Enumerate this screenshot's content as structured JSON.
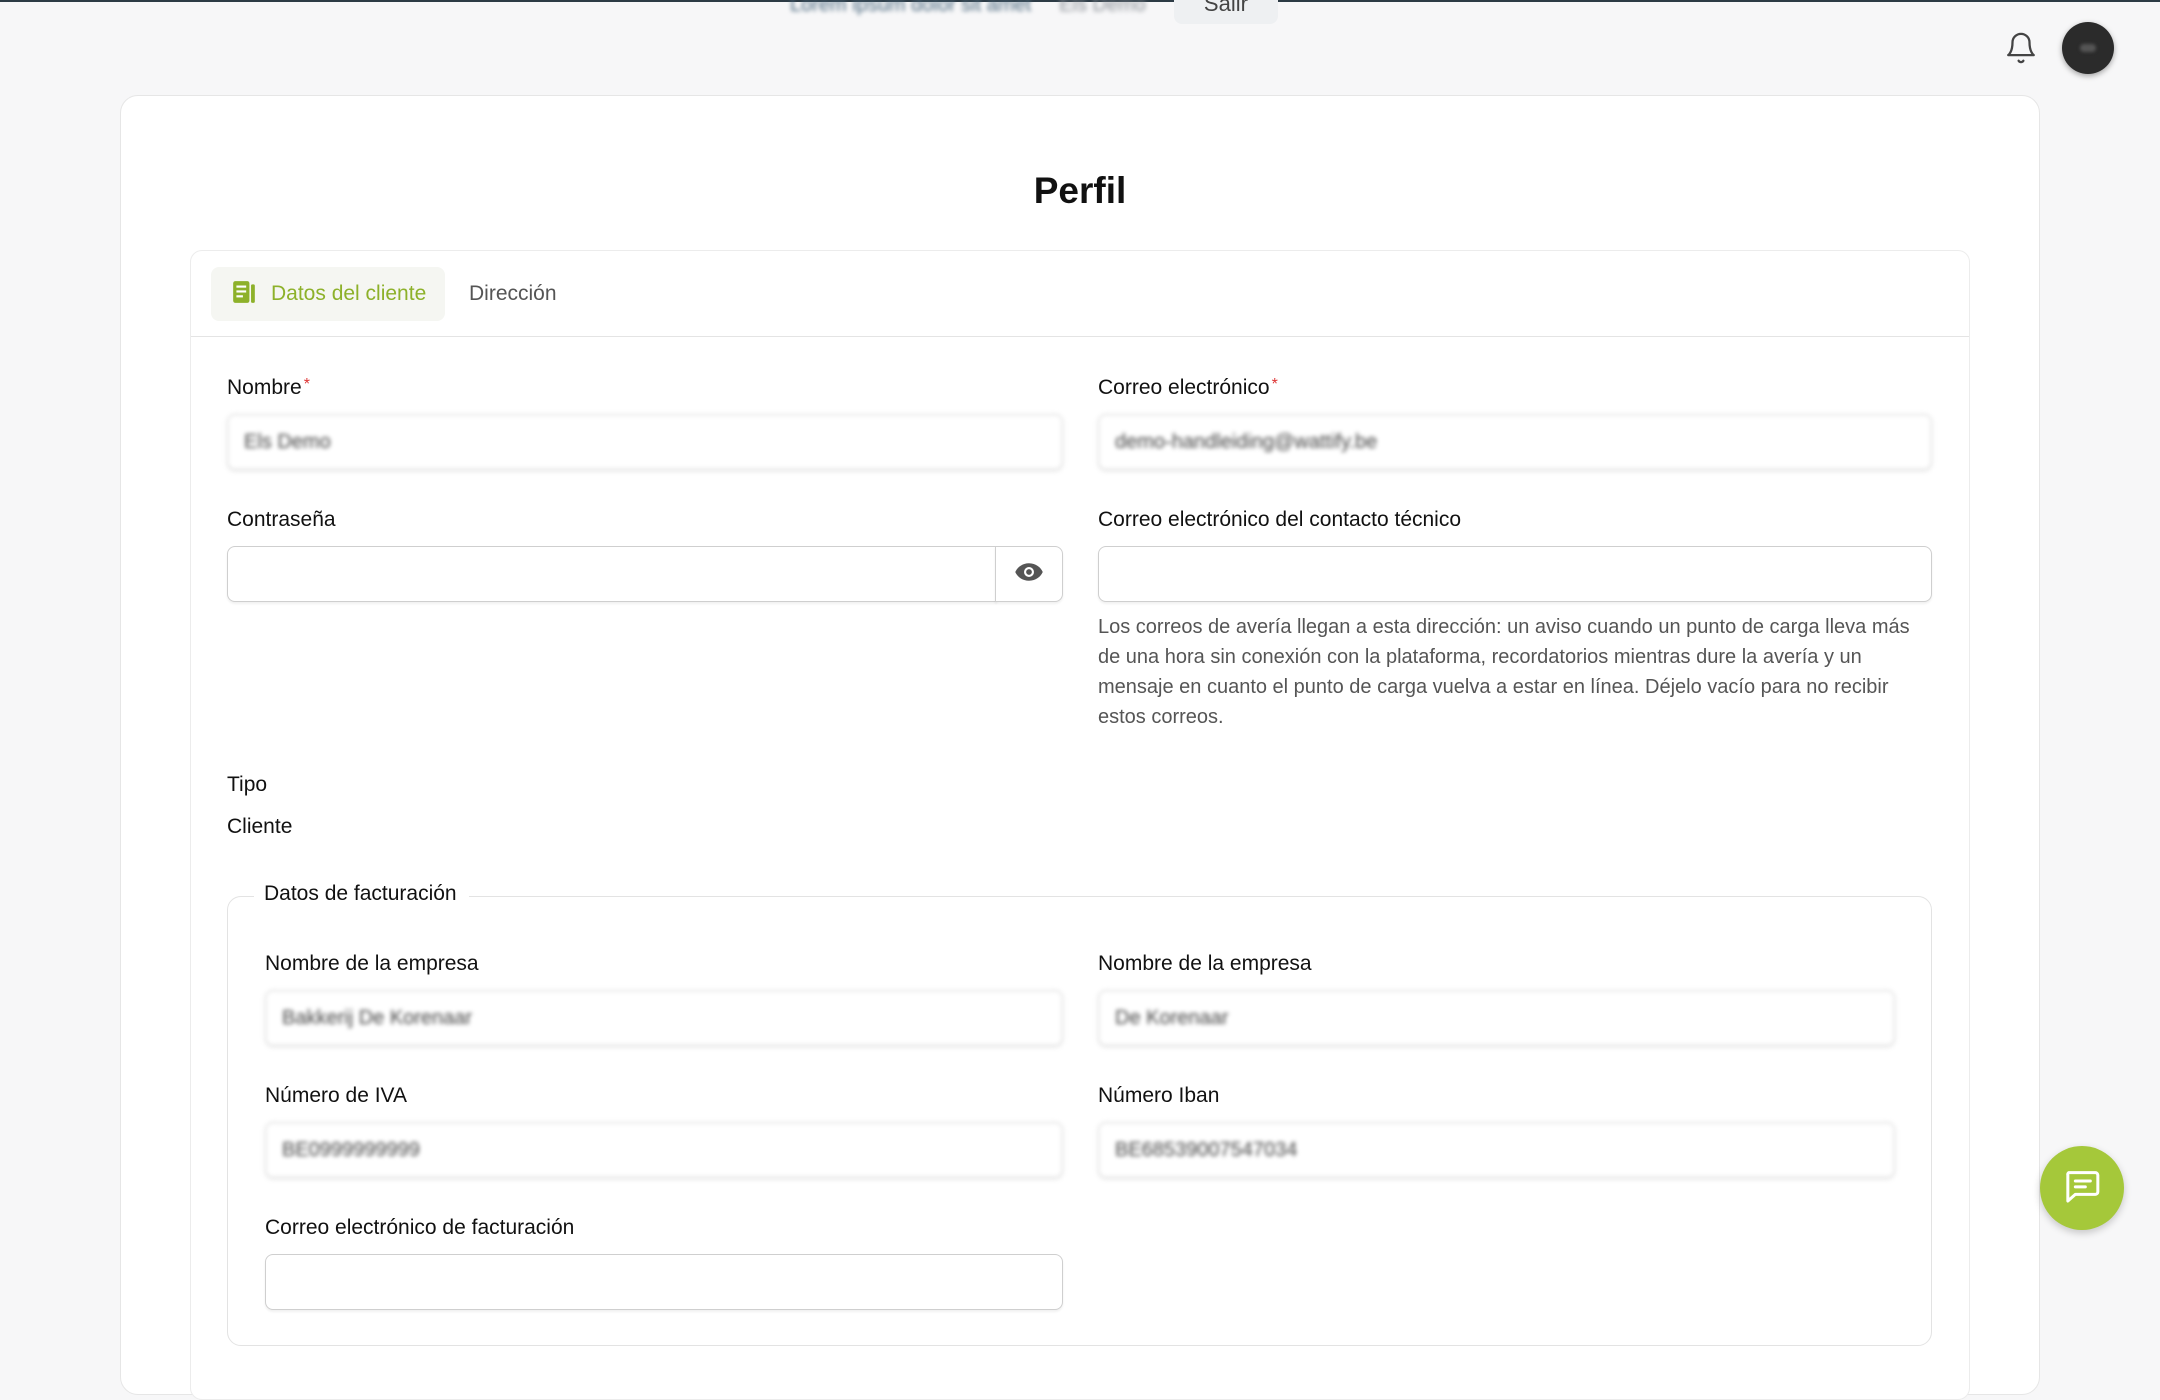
{
  "topbar": {
    "blurred_link": "Lorem ipsum dolor sit amet",
    "blurred_user": "Els Demo",
    "exit_label": "Salir"
  },
  "page": {
    "title": "Perfil"
  },
  "tabs": [
    {
      "label": "Datos del cliente",
      "icon": "document-icon",
      "active": true
    },
    {
      "label": "Dirección",
      "active": false
    }
  ],
  "form": {
    "name": {
      "label": "Nombre",
      "required_mark": "*",
      "value": "Els Demo"
    },
    "email": {
      "label": "Correo electrónico",
      "required_mark": "*",
      "value": "demo-handleiding@wattify.be"
    },
    "password": {
      "label": "Contraseña",
      "value": ""
    },
    "tech_email": {
      "label": "Correo electrónico del contacto técnico",
      "value": "",
      "help": "Los correos de avería llegan a esta dirección: un aviso cuando un punto de carga lleva más de una hora sin conexión con la plataforma, recordatorios mientras dure la avería y un mensaje en cuanto el punto de carga vuelva a estar en línea. Déjelo vacío para no recibir estos correos."
    },
    "type": {
      "label": "Tipo",
      "value": "Cliente"
    }
  },
  "billing": {
    "legend": "Datos de facturación",
    "company_name": {
      "label": "Nombre de la empresa",
      "value": "Bakkerij De Korenaar"
    },
    "company_name_2": {
      "label": "Nombre de la empresa",
      "value": "De Korenaar"
    },
    "vat": {
      "label": "Número de IVA",
      "value": "BE0999999999"
    },
    "iban": {
      "label": "Número Iban",
      "value": "BE68539007547034"
    },
    "billing_email": {
      "label": "Correo electrónico de facturación",
      "value": ""
    }
  },
  "colors": {
    "accent": "#8db12a",
    "fab": "#a5c83a",
    "required": "#dd3333"
  }
}
